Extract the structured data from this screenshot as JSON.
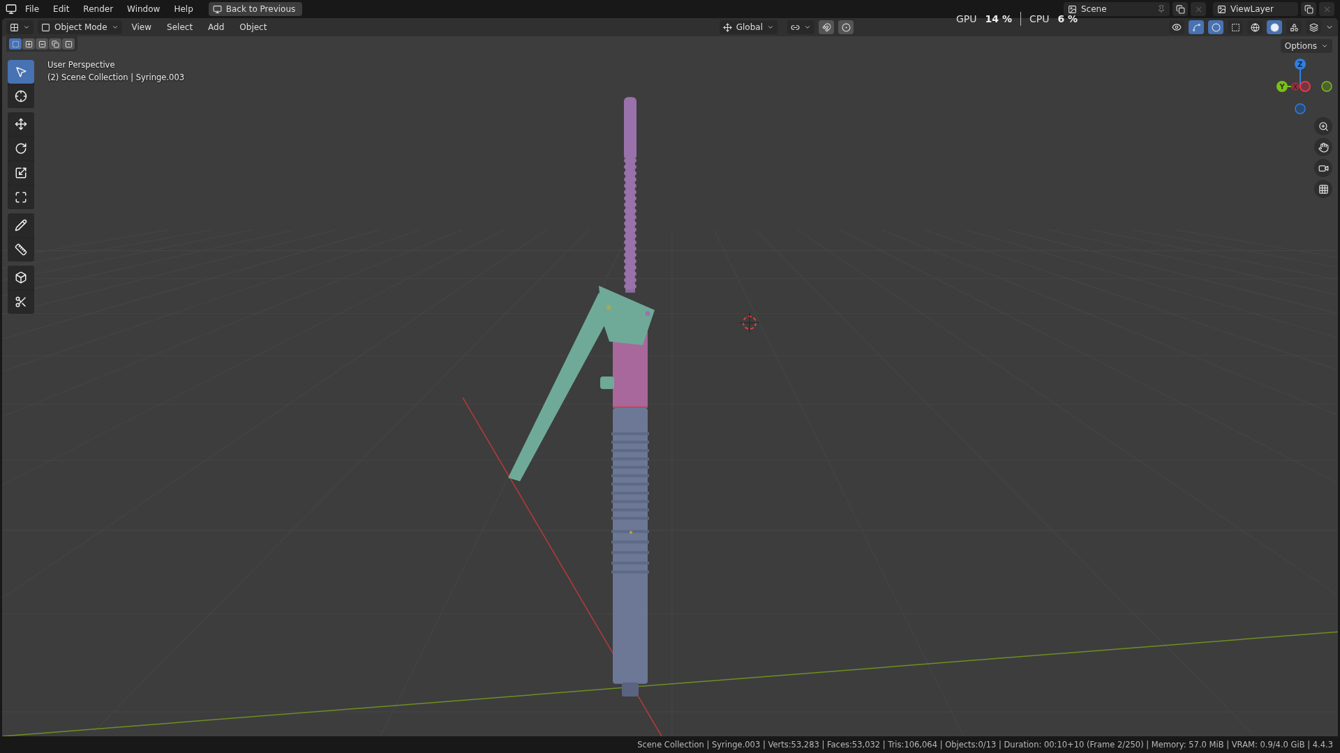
{
  "menu": [
    "File",
    "Edit",
    "Render",
    "Window",
    "Help"
  ],
  "back_button": "Back to Previous",
  "header": {
    "mode": "Object Mode",
    "menus": [
      "View",
      "Select",
      "Add",
      "Object"
    ],
    "orientation": "Global",
    "toggles": [
      {
        "kind": "snap",
        "on": true
      },
      {
        "kind": "proportional",
        "on": true
      },
      {
        "kind": "gizmos",
        "on": true
      },
      {
        "kind": "overlays",
        "on": true
      },
      {
        "kind": "xray",
        "on": false
      }
    ],
    "shading": [
      {
        "kind": "wireframe",
        "selected": false
      },
      {
        "kind": "solid",
        "selected": true
      },
      {
        "kind": "material",
        "selected": false
      },
      {
        "kind": "rendered",
        "selected": false
      }
    ]
  },
  "stats": [
    {
      "label": "GPU",
      "value": "14 %"
    },
    {
      "label": "CPU",
      "value": "6 %"
    }
  ],
  "scene": "Scene",
  "view_layer": "ViewLayer",
  "select_modes": [
    {
      "kind": "new",
      "selected": true
    },
    {
      "kind": "extend",
      "selected": false
    },
    {
      "kind": "subtract",
      "selected": false
    },
    {
      "kind": "invert",
      "selected": false
    },
    {
      "kind": "intersect",
      "selected": false
    }
  ],
  "tool_groups": [
    [
      {
        "kind": "select",
        "selected": true
      },
      {
        "kind": "cursor",
        "selected": false
      }
    ],
    [
      {
        "kind": "move",
        "selected": false
      },
      {
        "kind": "rotate",
        "selected": false
      },
      {
        "kind": "scale",
        "selected": false
      },
      {
        "kind": "transform",
        "selected": false
      }
    ],
    [
      {
        "kind": "annotate",
        "selected": false
      },
      {
        "kind": "measure",
        "selected": false
      }
    ],
    [
      {
        "kind": "add-cube",
        "selected": false
      },
      {
        "kind": "shear",
        "selected": false
      }
    ]
  ],
  "viewport": {
    "view_name": "User Perspective",
    "object_info": "(2) Scene Collection | Syringe.003",
    "options": "Options"
  },
  "gizmo": {
    "z": "Z",
    "y": "Y",
    "x": "X"
  },
  "status_bar": "Scene Collection | Syringe.003 | Verts:53,283 | Faces:53,032 | Tris:106,064 | Objects:0/13 | Duration: 00:10+10 (Frame 2/250) | Memory: 57.0 MiB | VRAM: 0.9/4.0 GiB | 4.4.3"
}
